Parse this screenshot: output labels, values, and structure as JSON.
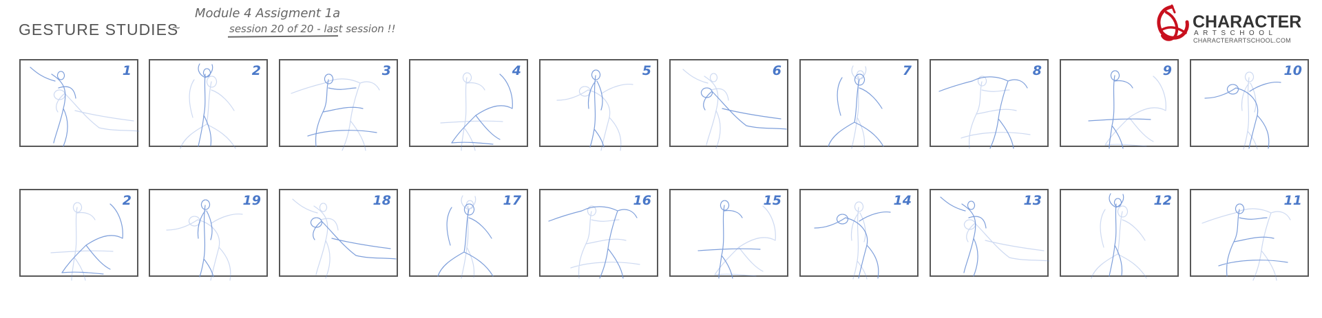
{
  "header": {
    "title": "GESTURE STUDIES",
    "title_dash": "~",
    "note_line1": "Module 4 Assigment 1a",
    "note_line2": "session 20 of 20 - last session !!"
  },
  "logo": {
    "name": "CHARACTER",
    "sub": "ARTSCHOOL",
    "url": "CHARACTERARTSCHOOL.COM",
    "accent_color": "#c8101e"
  },
  "colors": {
    "sketch": "#6f93d6",
    "number": "#4a78c8",
    "frame": "#575757"
  },
  "row1": {
    "numbers": [
      "1",
      "2",
      "3",
      "4",
      "5",
      "6",
      "7",
      "8",
      "9",
      "10"
    ]
  },
  "row2": {
    "numbers": [
      "2",
      "19",
      "18",
      "17",
      "16",
      "15",
      "14",
      "13",
      "12",
      "11"
    ]
  }
}
